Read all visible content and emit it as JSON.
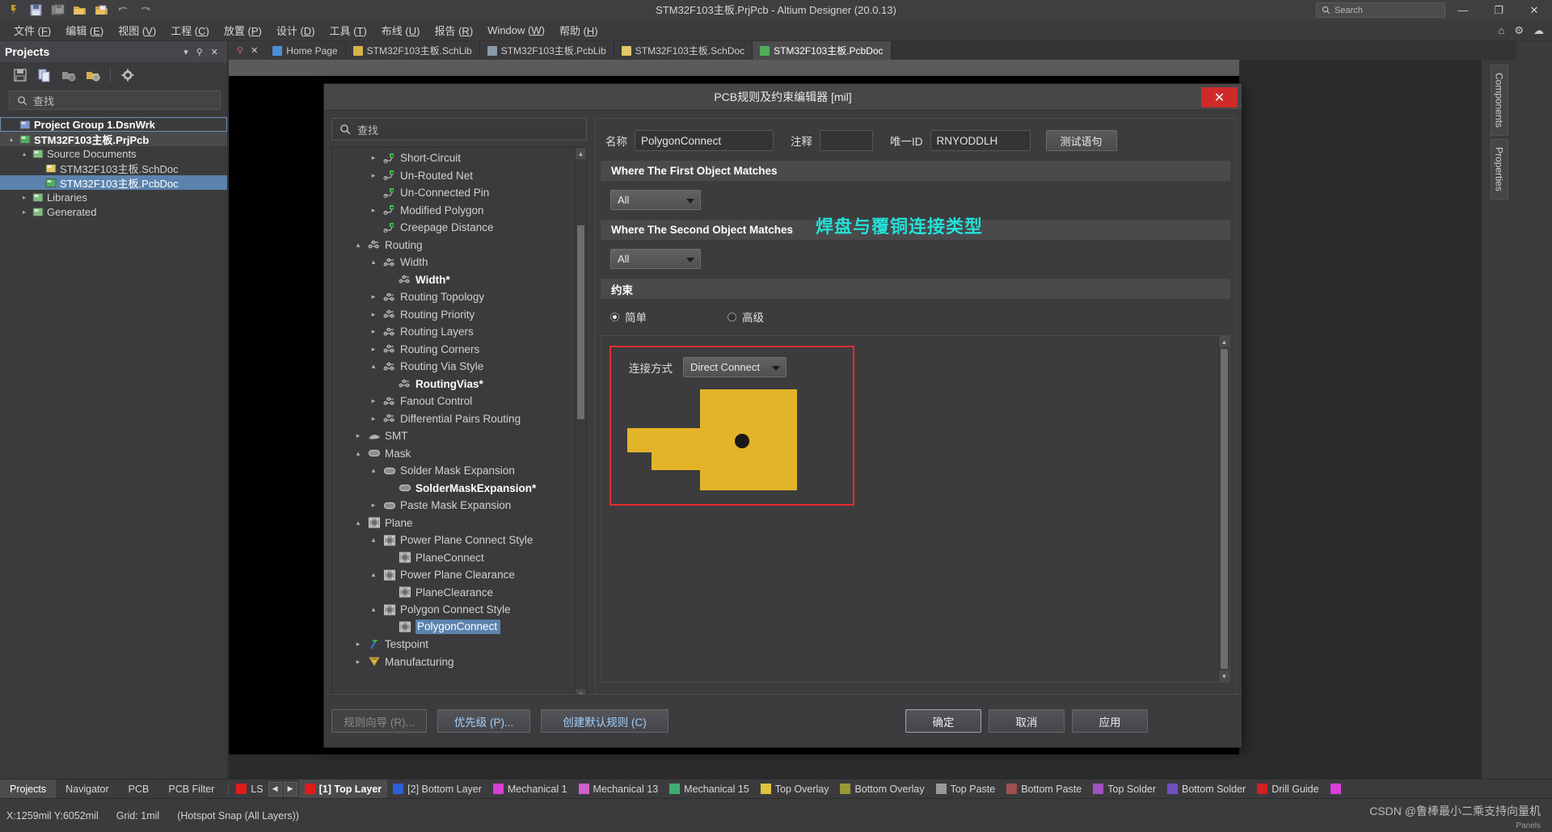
{
  "titlebar": {
    "title": "STM32F103主板.PrjPcb - Altium Designer (20.0.13)",
    "search_placeholder": "Search",
    "minimize": "—",
    "maximize": "❐",
    "close": "✕",
    "icons": [
      "altium-logo-icon",
      "save-icon",
      "save-all-icon",
      "open-icon",
      "open-project-icon",
      "undo-icon",
      "redo-icon"
    ]
  },
  "menubar": {
    "items": [
      {
        "label": "文件",
        "key": "F"
      },
      {
        "label": "编辑",
        "key": "E"
      },
      {
        "label": "视图",
        "key": "V"
      },
      {
        "label": "工程",
        "key": "C"
      },
      {
        "label": "放置",
        "key": "P"
      },
      {
        "label": "设计",
        "key": "D"
      },
      {
        "label": "工具",
        "key": "T"
      },
      {
        "label": "布线",
        "key": "U"
      },
      {
        "label": "报告",
        "key": "R"
      },
      {
        "label": "Window",
        "key": "W"
      },
      {
        "label": "帮助",
        "key": "H"
      }
    ],
    "right_icons": [
      "home-icon",
      "settings-icon",
      "user-icon"
    ]
  },
  "tabs": [
    {
      "label": "Home Page",
      "icon": "home-icon",
      "color": "#4a90d9",
      "active": false
    },
    {
      "label": "STM32F103主板.SchLib",
      "icon": "schlib-icon",
      "color": "#d8b24a",
      "active": false
    },
    {
      "label": "STM32F103主板.PcbLib",
      "icon": "pcblib-icon",
      "color": "#8a99a8",
      "active": false
    },
    {
      "label": "STM32F103主板.SchDoc",
      "icon": "schdoc-icon",
      "color": "#e3c766",
      "active": false
    },
    {
      "label": "STM32F103主板.PcbDoc",
      "icon": "pcbdoc-icon",
      "color": "#4fae5a",
      "active": true
    }
  ],
  "projects_panel": {
    "title": "Projects",
    "header_icons": [
      "chevron-down-icon",
      "pin-icon",
      "close-icon"
    ],
    "toolbar_icons": [
      "save-icon",
      "copy-icon",
      "compile-icon",
      "folder-options-icon",
      "gear-icon"
    ],
    "search_placeholder": "查找",
    "tree": [
      {
        "label": "Project Group 1.DsnWrk",
        "depth": 0,
        "twisty": "",
        "icon": "workspace-icon",
        "state": "outline",
        "bold": true
      },
      {
        "label": "STM32F103主板.PrjPcb",
        "depth": 0,
        "twisty": "▴",
        "icon": "project-icon",
        "state": "gray",
        "bold": true
      },
      {
        "label": "Source Documents",
        "depth": 1,
        "twisty": "▴",
        "icon": "folder-icon",
        "state": "",
        "bold": false
      },
      {
        "label": "STM32F103主板.SchDoc",
        "depth": 2,
        "twisty": "",
        "icon": "schdoc-icon",
        "state": "",
        "bold": false
      },
      {
        "label": "STM32F103主板.PcbDoc",
        "depth": 2,
        "twisty": "",
        "icon": "pcbdoc-icon",
        "state": "blue",
        "bold": false
      },
      {
        "label": "Libraries",
        "depth": 1,
        "twisty": "▸",
        "icon": "folder-icon",
        "state": "",
        "bold": false
      },
      {
        "label": "Generated",
        "depth": 1,
        "twisty": "▸",
        "icon": "folder-icon",
        "state": "",
        "bold": false
      }
    ]
  },
  "right_tool_tabs": [
    "Components",
    "Properties",
    "Panels"
  ],
  "dialog": {
    "title": "PCB规则及约束编辑器 [mil]",
    "close_label": "✕",
    "search_placeholder": "查找",
    "rules_tree": [
      {
        "label": "Short-Circuit",
        "depth": 2,
        "twisty": "▸",
        "icon": "electrical-icon",
        "bold": false,
        "sel": false
      },
      {
        "label": "Un-Routed Net",
        "depth": 2,
        "twisty": "▸",
        "icon": "electrical-icon",
        "bold": false,
        "sel": false
      },
      {
        "label": "Un-Connected Pin",
        "depth": 2,
        "twisty": "",
        "icon": "electrical-icon",
        "bold": false,
        "sel": false
      },
      {
        "label": "Modified Polygon",
        "depth": 2,
        "twisty": "▸",
        "icon": "electrical-icon",
        "bold": false,
        "sel": false
      },
      {
        "label": "Creepage Distance",
        "depth": 2,
        "twisty": "",
        "icon": "electrical-icon",
        "bold": false,
        "sel": false
      },
      {
        "label": "Routing",
        "depth": 1,
        "twisty": "▴",
        "icon": "routing-icon",
        "bold": false,
        "sel": false
      },
      {
        "label": "Width",
        "depth": 2,
        "twisty": "▴",
        "icon": "routing-icon",
        "bold": false,
        "sel": false
      },
      {
        "label": "Width*",
        "depth": 3,
        "twisty": "",
        "icon": "routing-icon",
        "bold": true,
        "sel": false
      },
      {
        "label": "Routing Topology",
        "depth": 2,
        "twisty": "▸",
        "icon": "routing-icon",
        "bold": false,
        "sel": false
      },
      {
        "label": "Routing Priority",
        "depth": 2,
        "twisty": "▸",
        "icon": "routing-icon",
        "bold": false,
        "sel": false
      },
      {
        "label": "Routing Layers",
        "depth": 2,
        "twisty": "▸",
        "icon": "routing-icon",
        "bold": false,
        "sel": false
      },
      {
        "label": "Routing Corners",
        "depth": 2,
        "twisty": "▸",
        "icon": "routing-icon",
        "bold": false,
        "sel": false
      },
      {
        "label": "Routing Via Style",
        "depth": 2,
        "twisty": "▴",
        "icon": "routing-icon",
        "bold": false,
        "sel": false
      },
      {
        "label": "RoutingVias*",
        "depth": 3,
        "twisty": "",
        "icon": "routing-icon",
        "bold": true,
        "sel": false
      },
      {
        "label": "Fanout Control",
        "depth": 2,
        "twisty": "▸",
        "icon": "routing-icon",
        "bold": false,
        "sel": false
      },
      {
        "label": "Differential Pairs Routing",
        "depth": 2,
        "twisty": "▸",
        "icon": "routing-icon",
        "bold": false,
        "sel": false
      },
      {
        "label": "SMT",
        "depth": 1,
        "twisty": "▸",
        "icon": "smt-icon",
        "bold": false,
        "sel": false
      },
      {
        "label": "Mask",
        "depth": 1,
        "twisty": "▴",
        "icon": "mask-icon",
        "bold": false,
        "sel": false
      },
      {
        "label": "Solder Mask Expansion",
        "depth": 2,
        "twisty": "▴",
        "icon": "mask-icon",
        "bold": false,
        "sel": false
      },
      {
        "label": "SolderMaskExpansion*",
        "depth": 3,
        "twisty": "",
        "icon": "mask-icon",
        "bold": true,
        "sel": false
      },
      {
        "label": "Paste Mask Expansion",
        "depth": 2,
        "twisty": "▸",
        "icon": "mask-icon",
        "bold": false,
        "sel": false
      },
      {
        "label": "Plane",
        "depth": 1,
        "twisty": "▴",
        "icon": "plane-icon",
        "bold": false,
        "sel": false
      },
      {
        "label": "Power Plane Connect Style",
        "depth": 2,
        "twisty": "▴",
        "icon": "plane-icon",
        "bold": false,
        "sel": false
      },
      {
        "label": "PlaneConnect",
        "depth": 3,
        "twisty": "",
        "icon": "plane-icon",
        "bold": false,
        "sel": false
      },
      {
        "label": "Power Plane Clearance",
        "depth": 2,
        "twisty": "▴",
        "icon": "plane-icon",
        "bold": false,
        "sel": false
      },
      {
        "label": "PlaneClearance",
        "depth": 3,
        "twisty": "",
        "icon": "plane-icon",
        "bold": false,
        "sel": false
      },
      {
        "label": "Polygon Connect Style",
        "depth": 2,
        "twisty": "▴",
        "icon": "plane-icon",
        "bold": false,
        "sel": false
      },
      {
        "label": "PolygonConnect",
        "depth": 3,
        "twisty": "",
        "icon": "plane-icon",
        "bold": false,
        "sel": true
      },
      {
        "label": "Testpoint",
        "depth": 1,
        "twisty": "▸",
        "icon": "testpoint-icon",
        "bold": false,
        "sel": false
      },
      {
        "label": "Manufacturing",
        "depth": 1,
        "twisty": "▸",
        "icon": "manufacturing-icon",
        "bold": false,
        "sel": false
      }
    ],
    "fields": {
      "name_label": "名称",
      "name_value": "PolygonConnect",
      "comment_label": "注释",
      "comment_value": "",
      "uniqueid_label": "唯一ID",
      "uniqueid_value": "RNYODDLH",
      "test_query_button": "测试语句"
    },
    "sections": {
      "first_object": "Where The First Object Matches",
      "first_object_scope": "All",
      "second_object": "Where The Second Object Matches",
      "second_object_scope": "All",
      "constraints": "约束"
    },
    "constraint_mode": {
      "simple_label": "简单",
      "simple_selected": true,
      "advanced_label": "高级",
      "advanced_selected": false
    },
    "connect": {
      "label": "连接方式",
      "value": "Direct Connect"
    },
    "annotation": "焊盘与覆铜连接类型",
    "footer_buttons": [
      {
        "label": "规则向导 (R)...",
        "disabled": true,
        "style": "plain"
      },
      {
        "label": "优先级 (P)...",
        "disabled": false,
        "style": "blue"
      },
      {
        "label": "创建默认规则 (C)",
        "disabled": false,
        "style": "blue"
      },
      {
        "label": "确定",
        "disabled": false,
        "style": "primary"
      },
      {
        "label": "取消",
        "disabled": false,
        "style": "plain"
      },
      {
        "label": "应用",
        "disabled": false,
        "style": "plain"
      }
    ]
  },
  "panels_bar": {
    "tabs": [
      {
        "label": "Projects",
        "sel": true
      },
      {
        "label": "Navigator",
        "sel": false
      },
      {
        "label": "PCB",
        "sel": false
      },
      {
        "label": "PCB Filter",
        "sel": false
      }
    ],
    "ls_label": "LS",
    "nav_prev": "◀",
    "nav_next": "▶",
    "current_color": "#e01b1b",
    "layers": [
      {
        "label": "[1] Top Layer",
        "color": "#e01b1b",
        "active": true
      },
      {
        "label": "[2] Bottom Layer",
        "color": "#2c5fd6",
        "active": false
      },
      {
        "label": "Mechanical 1",
        "color": "#d83fd8",
        "active": false
      },
      {
        "label": "Mechanical 13",
        "color": "#cf5fc8",
        "active": false
      },
      {
        "label": "Mechanical 15",
        "color": "#3fae6f",
        "active": false
      },
      {
        "label": "Top Overlay",
        "color": "#e0c33a",
        "active": false
      },
      {
        "label": "Bottom Overlay",
        "color": "#9a9a33",
        "active": false
      },
      {
        "label": "Top Paste",
        "color": "#9a9a9a",
        "active": false
      },
      {
        "label": "Bottom Paste",
        "color": "#a05050",
        "active": false
      },
      {
        "label": "Top Solder",
        "color": "#a050c0",
        "active": false
      },
      {
        "label": "Bottom Solder",
        "color": "#7050c0",
        "active": false
      },
      {
        "label": "Drill Guide",
        "color": "#d02020",
        "active": false
      },
      {
        "label": "",
        "color": "#d83fd8",
        "active": false
      }
    ]
  },
  "statusbar": {
    "coords": "X:1259mil Y:6052mil",
    "grid": "Grid: 1mil",
    "snap": "(Hotspot Snap (All Layers))",
    "watermark": "CSDN @鲁棒最小二乘支持向量机",
    "watermark2": "Panels"
  }
}
